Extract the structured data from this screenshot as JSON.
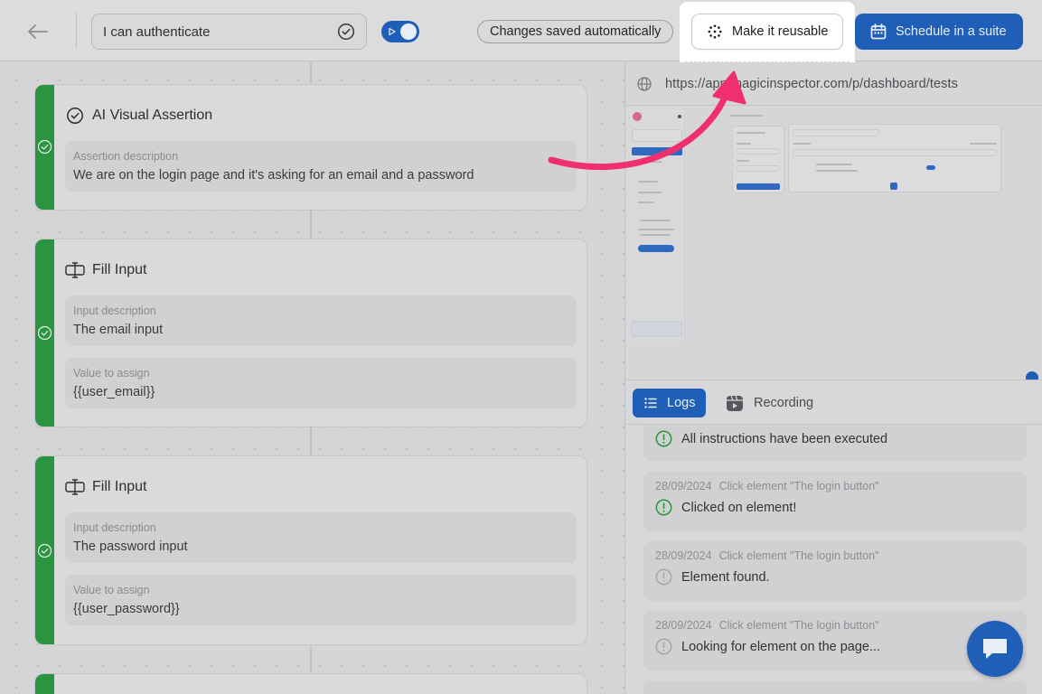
{
  "header": {
    "back_icon": "arrow-left-icon",
    "test_name": "I can authenticate",
    "save_status": "Changes saved automatically",
    "reuse_label": "Make it reusable",
    "schedule_label": "Schedule in a suite",
    "accent_color": "#1f5fb8"
  },
  "steps": [
    {
      "type": "AI Visual Assertion",
      "icon": "check-circle-icon",
      "status": "success",
      "fields": [
        {
          "label": "Assertion description",
          "value": "We are on the login page and it's asking for an email and a password"
        }
      ]
    },
    {
      "type": "Fill Input",
      "icon": "text-cursor-icon",
      "status": "success",
      "fields": [
        {
          "label": "Input description",
          "value": "The email input"
        },
        {
          "label": "Value to assign",
          "value": "{{user_email}}"
        }
      ]
    },
    {
      "type": "Fill Input",
      "icon": "text-cursor-icon",
      "status": "success",
      "fields": [
        {
          "label": "Input description",
          "value": "The password input"
        },
        {
          "label": "Value to assign",
          "value": "{{user_password}}"
        }
      ]
    }
  ],
  "browser": {
    "url": "https://app.magicinspector.com/p/dashboard/tests"
  },
  "tabs": {
    "logs": "Logs",
    "recording": "Recording"
  },
  "logs": [
    {
      "date": "",
      "action": "",
      "message": "All instructions have been executed",
      "status": "success"
    },
    {
      "date": "28/09/2024",
      "action": "Click element \"The login button\"",
      "message": "Clicked on element!",
      "status": "success"
    },
    {
      "date": "28/09/2024",
      "action": "Click element \"The login button\"",
      "message": "Element found.",
      "status": "info"
    },
    {
      "date": "28/09/2024",
      "action": "Click element \"The login button\"",
      "message": "Looking for element on the page...",
      "status": "info"
    }
  ],
  "colors": {
    "success": "#2a9441",
    "info": "#a5a5a9",
    "highlight_arrow": "#f0306e"
  }
}
